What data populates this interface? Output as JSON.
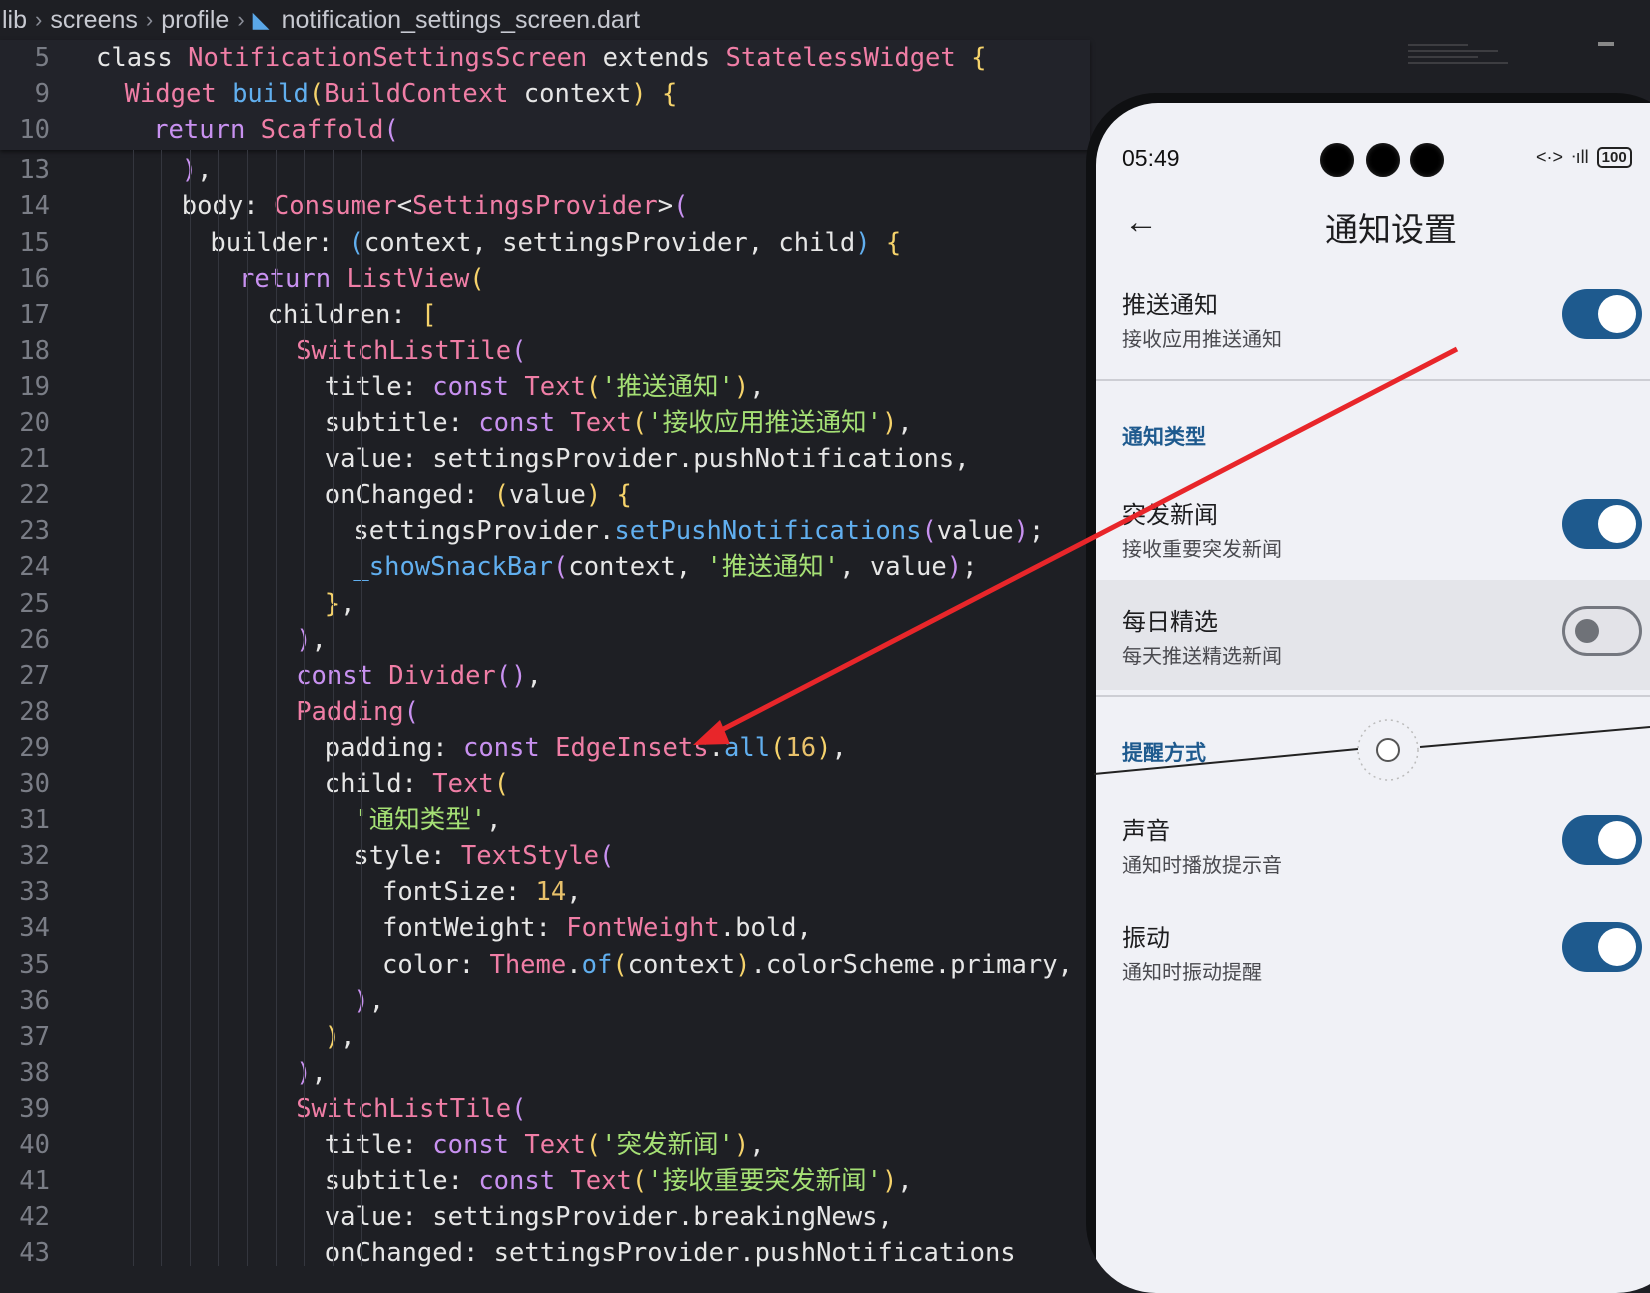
{
  "breadcrumb": [
    "lib",
    "screens",
    "profile",
    "notification_settings_screen.dart"
  ],
  "code_lines": [
    {
      "n": "5",
      "indent": 3,
      "parts": [
        [
          "pl",
          "class "
        ],
        [
          "ty",
          "NotificationSettingsScreen"
        ],
        [
          "pl",
          " extends "
        ],
        [
          "ty",
          "StatelessWidget"
        ],
        [
          "br1",
          " {"
        ]
      ]
    },
    {
      "n": "9",
      "indent": 4,
      "parts": [
        [
          "ty",
          "Widget"
        ],
        [
          "fn",
          " build"
        ],
        [
          "br1",
          "("
        ],
        [
          "ty",
          "BuildContext"
        ],
        [
          "pl",
          " context"
        ],
        [
          "br1",
          ")"
        ],
        [
          "br1",
          " {"
        ]
      ]
    },
    {
      "n": "10",
      "indent": 5,
      "parts": [
        [
          "kw",
          "return"
        ],
        [
          "ty",
          " Scaffold"
        ],
        [
          "kw",
          "("
        ]
      ]
    },
    {
      "n": "13",
      "indent": 6,
      "parts": [
        [
          "kw",
          ")"
        ],
        [
          "pl",
          ","
        ]
      ]
    },
    {
      "n": "14",
      "indent": 6,
      "parts": [
        [
          "pl",
          "body: "
        ],
        [
          "ty",
          "Consumer"
        ],
        [
          "pl",
          "<"
        ],
        [
          "ty",
          "SettingsProvider"
        ],
        [
          "pl",
          ">"
        ],
        [
          "kw",
          "("
        ]
      ]
    },
    {
      "n": "15",
      "indent": 7,
      "parts": [
        [
          "pl",
          "builder: "
        ],
        [
          "fn",
          "("
        ],
        [
          "pl",
          "context, settingsProvider, child"
        ],
        [
          "fn",
          ")"
        ],
        [
          "br1",
          " {"
        ]
      ]
    },
    {
      "n": "16",
      "indent": 8,
      "parts": [
        [
          "kw",
          "return"
        ],
        [
          "ty",
          " ListView"
        ],
        [
          "br1",
          "("
        ]
      ]
    },
    {
      "n": "17",
      "indent": 9,
      "parts": [
        [
          "pl",
          "children: "
        ],
        [
          "br1",
          "["
        ]
      ]
    },
    {
      "n": "18",
      "indent": 10,
      "parts": [
        [
          "ty",
          "SwitchListTile"
        ],
        [
          "kw",
          "("
        ]
      ]
    },
    {
      "n": "19",
      "indent": 11,
      "parts": [
        [
          "pl",
          "title: "
        ],
        [
          "kw",
          "const"
        ],
        [
          "ty",
          " Text"
        ],
        [
          "br1",
          "("
        ],
        [
          "str",
          "'推送通知'"
        ],
        [
          "br1",
          ")"
        ],
        [
          "pl",
          ","
        ]
      ]
    },
    {
      "n": "20",
      "indent": 11,
      "parts": [
        [
          "pl",
          "subtitle: "
        ],
        [
          "kw",
          "const"
        ],
        [
          "ty",
          " Text"
        ],
        [
          "br1",
          "("
        ],
        [
          "str",
          "'接收应用推送通知'"
        ],
        [
          "br1",
          ")"
        ],
        [
          "pl",
          ","
        ]
      ]
    },
    {
      "n": "21",
      "indent": 11,
      "parts": [
        [
          "pl",
          "value: settingsProvider.pushNotifications,"
        ]
      ]
    },
    {
      "n": "22",
      "indent": 11,
      "parts": [
        [
          "pl",
          "onChanged: "
        ],
        [
          "br1",
          "("
        ],
        [
          "pl",
          "value"
        ],
        [
          "br1",
          ")"
        ],
        [
          "br1",
          " {"
        ]
      ]
    },
    {
      "n": "23",
      "indent": 12,
      "parts": [
        [
          "pl",
          "settingsProvider."
        ],
        [
          "fn",
          "setPushNotifications"
        ],
        [
          "kw",
          "("
        ],
        [
          "pl",
          "value"
        ],
        [
          "kw",
          ")"
        ],
        [
          "pl",
          ";"
        ]
      ]
    },
    {
      "n": "24",
      "indent": 12,
      "parts": [
        [
          "fn",
          "_showSnackBar"
        ],
        [
          "kw",
          "("
        ],
        [
          "pl",
          "context, "
        ],
        [
          "str",
          "'推送通知'"
        ],
        [
          "pl",
          ", value"
        ],
        [
          "kw",
          ")"
        ],
        [
          "pl",
          ";"
        ]
      ]
    },
    {
      "n": "25",
      "indent": 11,
      "parts": [
        [
          "br1",
          "}"
        ],
        [
          "pl",
          ","
        ]
      ]
    },
    {
      "n": "26",
      "indent": 10,
      "parts": [
        [
          "kw",
          ")"
        ],
        [
          "pl",
          ","
        ]
      ]
    },
    {
      "n": "27",
      "indent": 10,
      "parts": [
        [
          "kw",
          "const"
        ],
        [
          "ty",
          " Divider"
        ],
        [
          "kw",
          "()"
        ],
        [
          "pl",
          ","
        ]
      ]
    },
    {
      "n": "28",
      "indent": 10,
      "parts": [
        [
          "ty",
          "Padding"
        ],
        [
          "kw",
          "("
        ]
      ]
    },
    {
      "n": "29",
      "indent": 11,
      "parts": [
        [
          "pl",
          "padding: "
        ],
        [
          "kw",
          "const"
        ],
        [
          "ty",
          " EdgeInsets"
        ],
        [
          "pl",
          "."
        ],
        [
          "fn",
          "all"
        ],
        [
          "br1",
          "("
        ],
        [
          "num",
          "16"
        ],
        [
          "br1",
          ")"
        ],
        [
          "pl",
          ","
        ]
      ]
    },
    {
      "n": "30",
      "indent": 11,
      "parts": [
        [
          "pl",
          "child: "
        ],
        [
          "ty",
          "Text"
        ],
        [
          "br1",
          "("
        ]
      ]
    },
    {
      "n": "31",
      "indent": 12,
      "parts": [
        [
          "str",
          "'通知类型'"
        ],
        [
          "pl",
          ","
        ]
      ]
    },
    {
      "n": "32",
      "indent": 12,
      "parts": [
        [
          "pl",
          "style: "
        ],
        [
          "ty",
          "TextStyle"
        ],
        [
          "kw",
          "("
        ]
      ]
    },
    {
      "n": "33",
      "indent": 13,
      "parts": [
        [
          "pl",
          "fontSize: "
        ],
        [
          "num",
          "14"
        ],
        [
          "pl",
          ","
        ]
      ]
    },
    {
      "n": "34",
      "indent": 13,
      "parts": [
        [
          "pl",
          "fontWeight: "
        ],
        [
          "ty",
          "FontWeight"
        ],
        [
          "pl",
          ".bold,"
        ]
      ]
    },
    {
      "n": "35",
      "indent": 13,
      "parts": [
        [
          "pl",
          "color: "
        ],
        [
          "ty",
          "Theme"
        ],
        [
          "pl",
          "."
        ],
        [
          "fn",
          "of"
        ],
        [
          "br1",
          "("
        ],
        [
          "pl",
          "context"
        ],
        [
          "br1",
          ")"
        ],
        [
          "pl",
          ".colorScheme.primary,"
        ]
      ]
    },
    {
      "n": "36",
      "indent": 12,
      "parts": [
        [
          "kw",
          ")"
        ],
        [
          "pl",
          ","
        ]
      ]
    },
    {
      "n": "37",
      "indent": 11,
      "parts": [
        [
          "br1",
          ")"
        ],
        [
          "pl",
          ","
        ]
      ]
    },
    {
      "n": "38",
      "indent": 10,
      "parts": [
        [
          "kw",
          ")"
        ],
        [
          "pl",
          ","
        ]
      ]
    },
    {
      "n": "39",
      "indent": 10,
      "parts": [
        [
          "ty",
          "SwitchListTile"
        ],
        [
          "kw",
          "("
        ]
      ]
    },
    {
      "n": "40",
      "indent": 11,
      "parts": [
        [
          "pl",
          "title: "
        ],
        [
          "kw",
          "const"
        ],
        [
          "ty",
          " Text"
        ],
        [
          "br1",
          "("
        ],
        [
          "str",
          "'突发新闻'"
        ],
        [
          "br1",
          ")"
        ],
        [
          "pl",
          ","
        ]
      ]
    },
    {
      "n": "41",
      "indent": 11,
      "parts": [
        [
          "pl",
          "subtitle: "
        ],
        [
          "kw",
          "const"
        ],
        [
          "ty",
          " Text"
        ],
        [
          "br1",
          "("
        ],
        [
          "str",
          "'接收重要突发新闻'"
        ],
        [
          "br1",
          ")"
        ],
        [
          "pl",
          ","
        ]
      ]
    },
    {
      "n": "42",
      "indent": 11,
      "parts": [
        [
          "pl",
          "value: settingsProvider.breakingNews,"
        ]
      ]
    },
    {
      "n": "43",
      "indent": 11,
      "parts": [
        [
          "pl",
          "onChanged: settingsProvider.pushNotifications"
        ]
      ]
    }
  ],
  "phone": {
    "time": "05:49",
    "battery": "100",
    "title": "通知设置",
    "back_icon": "arrow-back-icon",
    "push": {
      "title": "推送通知",
      "subtitle": "接收应用推送通知",
      "on": true
    },
    "section_types": "通知类型",
    "breaking": {
      "title": "突发新闻",
      "subtitle": "接收重要突发新闻",
      "on": true
    },
    "daily": {
      "title": "每日精选",
      "subtitle": "每天推送精选新闻",
      "on": false
    },
    "section_method": "提醒方式",
    "sound": {
      "title": "声音",
      "subtitle": "通知时播放提示音",
      "on": true
    },
    "vibrate": {
      "title": "振动",
      "subtitle": "通知时振动提醒",
      "on": true
    }
  },
  "colors": {
    "accent": "#1e5a8e",
    "annotation_arrow": "#e8262a"
  }
}
